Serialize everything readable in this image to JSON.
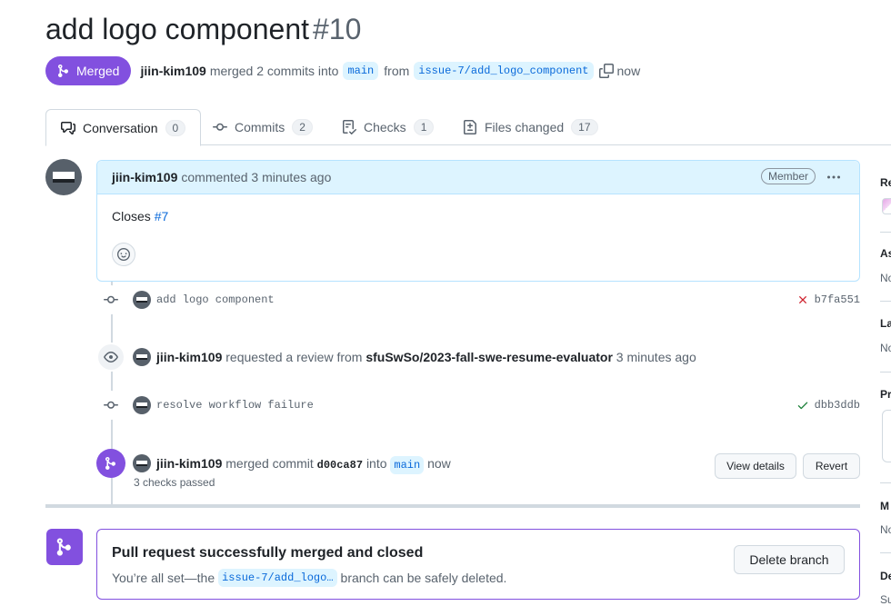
{
  "header": {
    "title": "add logo component",
    "number": "#10",
    "status": "Merged",
    "author": "jiin-kim109",
    "action": "merged 2 commits into",
    "base_branch": "main",
    "from_label": "from",
    "head_branch": "issue-7/add_logo_component",
    "time": "now"
  },
  "tabs": [
    {
      "label": "Conversation",
      "count": "0",
      "icon": "comment-discussion-icon"
    },
    {
      "label": "Commits",
      "count": "2",
      "icon": "git-commit-icon"
    },
    {
      "label": "Checks",
      "count": "1",
      "icon": "checklist-icon"
    },
    {
      "label": "Files changed",
      "count": "17",
      "icon": "file-diff-icon"
    }
  ],
  "comment": {
    "author": "jiin-kim109",
    "meta": "commented 3 minutes ago",
    "role": "Member",
    "body_prefix": "Closes",
    "body_link": "#7"
  },
  "timeline": {
    "commit1": {
      "message": "add logo component",
      "sha": "b7fa551",
      "status": "failure"
    },
    "review": {
      "author": "jiin-kim109",
      "text": "requested a review from",
      "target": "sfuSwSo/2023-fall-swe-resume-evaluator",
      "time": "3 minutes ago"
    },
    "commit2": {
      "message": "resolve workflow failure",
      "sha": "dbb3ddb",
      "status": "success"
    },
    "merged": {
      "author": "jiin-kim109",
      "text": "merged commit",
      "sha": "d00ca87",
      "into": "into",
      "branch": "main",
      "time": "now",
      "checks": "3 checks passed",
      "view_details": "View details",
      "revert": "Revert"
    }
  },
  "merge_box": {
    "title": "Pull request successfully merged and closed",
    "sub_prefix": "You’re all set—the",
    "branch": "issue-7/add_logo…",
    "sub_suffix": "branch can be safely deleted.",
    "delete_button": "Delete branch"
  },
  "sidebar": {
    "items": [
      {
        "head": "Re",
        "value": ""
      },
      {
        "head": "As",
        "value": "No"
      },
      {
        "head": "La",
        "value": "No"
      },
      {
        "head": "Pr",
        "value": ""
      },
      {
        "head": "M",
        "value": "No"
      },
      {
        "head": "De",
        "value": "Su"
      }
    ]
  },
  "colors": {
    "merged_purple": "#8250df",
    "link_blue": "#0969da",
    "fail_red": "#cf222e",
    "success_green": "#1a7f37"
  }
}
